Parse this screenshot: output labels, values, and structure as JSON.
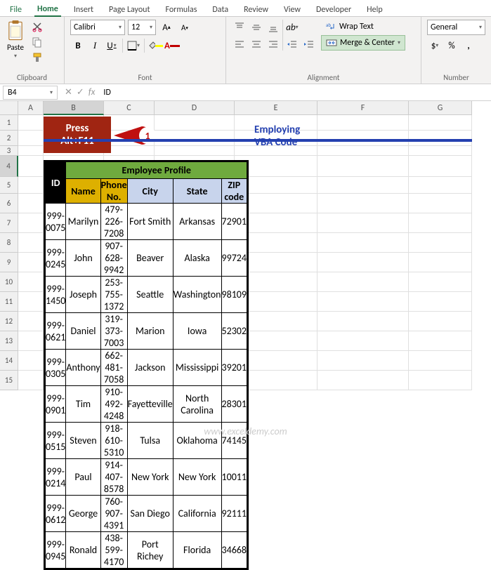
{
  "menu": {
    "file": "File",
    "home": "Home",
    "insert": "Insert",
    "page_layout": "Page Layout",
    "formulas": "Formulas",
    "data": "Data",
    "review": "Review",
    "view": "View",
    "developer": "Developer",
    "help": "Help"
  },
  "ribbon": {
    "clipboard": {
      "label": "Clipboard",
      "paste": "Paste"
    },
    "font": {
      "label": "Font",
      "name": "Calibri",
      "size": "12"
    },
    "alignment": {
      "label": "Alignment",
      "wrap": "Wrap Text",
      "merge": "Merge & Center"
    },
    "number": {
      "label": "Number",
      "format": "General"
    }
  },
  "namebox": "B4",
  "formula": "ID",
  "columns": [
    "A",
    "B",
    "C",
    "D",
    "E",
    "F",
    "G"
  ],
  "title": "Employing VBA Code",
  "callout": {
    "line1": "Press",
    "line2": "Alt+F11",
    "badge": "1"
  },
  "headers": {
    "id": "ID",
    "profile": "Employee Profile",
    "name": "Name",
    "phone": "Phone No.",
    "city": "City",
    "state": "State",
    "zip": "ZIP code"
  },
  "rows": [
    {
      "id": "999-0075",
      "name": "Marilyn",
      "phone": "479-226-7208",
      "city": "Fort Smith",
      "state": "Arkansas",
      "zip": "72901"
    },
    {
      "id": "999-0245",
      "name": "John",
      "phone": "907-628-9942",
      "city": "Beaver",
      "state": "Alaska",
      "zip": "99724"
    },
    {
      "id": "999-1450",
      "name": "Joseph",
      "phone": "253-755-1372",
      "city": "Seattle",
      "state": "Washington",
      "zip": "98109"
    },
    {
      "id": "999-0621",
      "name": "Daniel",
      "phone": "319-373-7003",
      "city": "Marion",
      "state": "Iowa",
      "zip": "52302"
    },
    {
      "id": "999-0305",
      "name": "Anthony",
      "phone": "662-481-7058",
      "city": "Jackson",
      "state": "Mississippi",
      "zip": "39201"
    },
    {
      "id": "999-0901",
      "name": "Tim",
      "phone": "910-492-4248",
      "city": "Fayetteville",
      "state": "North Carolina",
      "zip": "28301"
    },
    {
      "id": "999-0515",
      "name": "Steven",
      "phone": "918-610-5310",
      "city": "Tulsa",
      "state": "Oklahoma",
      "zip": "74145"
    },
    {
      "id": "999-0214",
      "name": "Paul",
      "phone": "914-407-8578",
      "city": "New York",
      "state": "New York",
      "zip": "10011"
    },
    {
      "id": "999-0612",
      "name": "George",
      "phone": "760-907-4391",
      "city": "San Diego",
      "state": "California",
      "zip": "92111"
    },
    {
      "id": "999-0945",
      "name": "Ronald",
      "phone": "438-599-4170",
      "city": "Port Richey",
      "state": "Florida",
      "zip": "34668"
    }
  ],
  "watermark": "www.exceldemy.com"
}
